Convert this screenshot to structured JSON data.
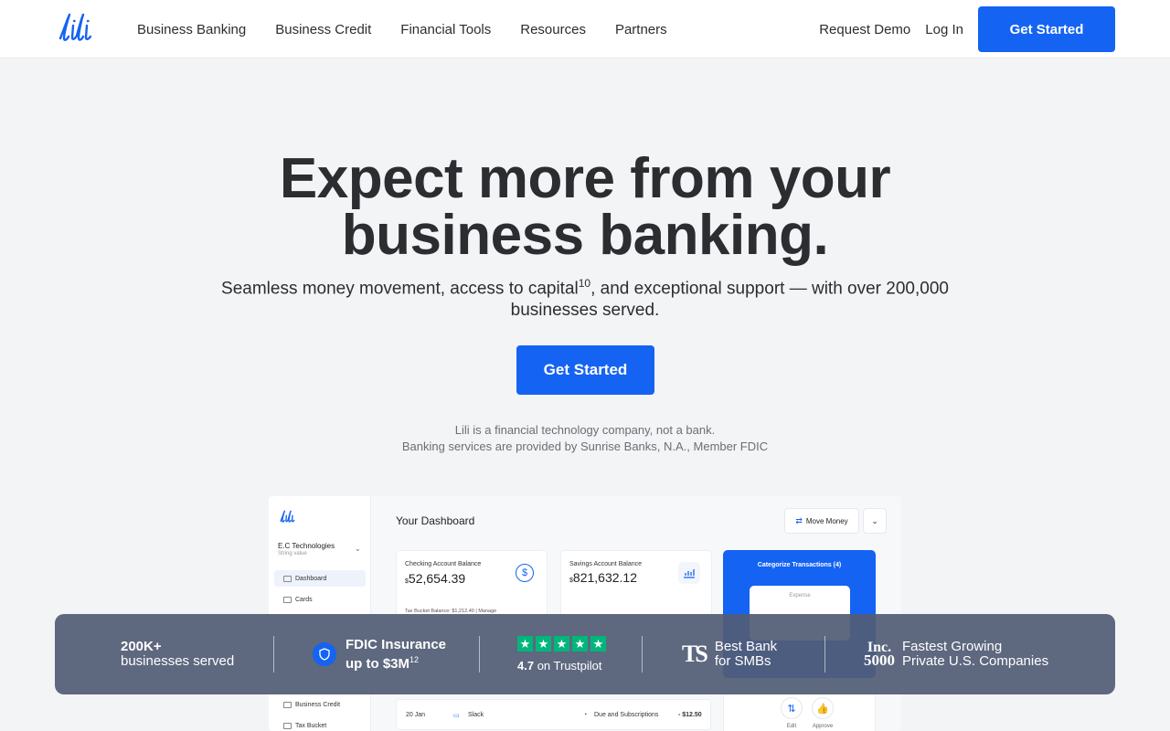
{
  "header": {
    "logo_text": "lili",
    "nav": [
      "Business Banking",
      "Business Credit",
      "Financial Tools",
      "Resources",
      "Partners"
    ],
    "request_demo": "Request Demo",
    "login": "Log In",
    "cta": "Get Started"
  },
  "hero": {
    "title_line1": "Expect more from your",
    "title_line2": "business banking.",
    "subtitle_a": "Seamless money movement, access to capital",
    "subtitle_sup": "10",
    "subtitle_b": ", and exceptional support — with over 200,000 businesses served.",
    "cta": "Get Started",
    "disclaimer1": "Lili is a financial technology company, not a bank.",
    "disclaimer2": "Banking services are provided by Sunrise Banks, N.A., Member FDIC"
  },
  "dashboard": {
    "company": "E.C Technologies",
    "company_sub": "String value",
    "sidebar": [
      "Dashboard",
      "Cards",
      "Business Credit",
      "Tax Bucket"
    ],
    "title": "Your Dashboard",
    "move_money": "Move Money",
    "checking_label": "Checking Account Balance",
    "checking_currency": "$",
    "checking_amount": "52,654.39",
    "tax_bucket": "Tax Bucket Balance: $1,212.40  |  Manage",
    "savings_label": "Savings Account Balance",
    "savings_currency": "$",
    "savings_amount": "821,632.12",
    "categorize": "Categorize Transactions (4)",
    "expense": "Expense",
    "tx_date": "20 Jan",
    "tx_merchant": "Slack",
    "tx_category": "Due and Subscriptions",
    "tx_amount": "- $12.50",
    "edit": "Edit",
    "approve": "Approve"
  },
  "stats": {
    "s1_line1": "200K+",
    "s1_line2": "businesses served",
    "s2_line1": "FDIC Insurance",
    "s2_line2": "up to $3M",
    "s2_sup": "12",
    "s3_rating": "4.7",
    "s3_text": "on Trustpilot",
    "s4_logo": "TS",
    "s4_line1": "Best Bank",
    "s4_line2": "for SMBs",
    "s5_logo1": "Inc.",
    "s5_logo2": "5000",
    "s5_line1": "Fastest Growing",
    "s5_line2": "Private U.S. Companies"
  },
  "colors": {
    "primary": "#1463f3",
    "trustpilot": "#00b67a",
    "stats_bg": "#525d75"
  }
}
